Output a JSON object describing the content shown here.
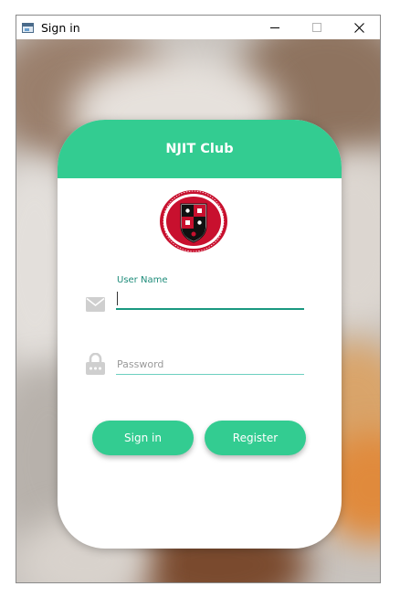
{
  "window": {
    "title": "Sign in",
    "controls": [
      "minimize",
      "maximize",
      "close"
    ]
  },
  "card": {
    "title": "NJIT Club",
    "accent_color": "#33cc91",
    "logo_alt": "New Jersey Institute of Technology seal"
  },
  "form": {
    "username_label": "User Name",
    "username_value": "",
    "password_placeholder": "Password",
    "password_value": ""
  },
  "buttons": {
    "signin_label": "Sign in",
    "register_label": "Register"
  },
  "icons": {
    "username": "mail-icon",
    "password": "lock-icon"
  }
}
